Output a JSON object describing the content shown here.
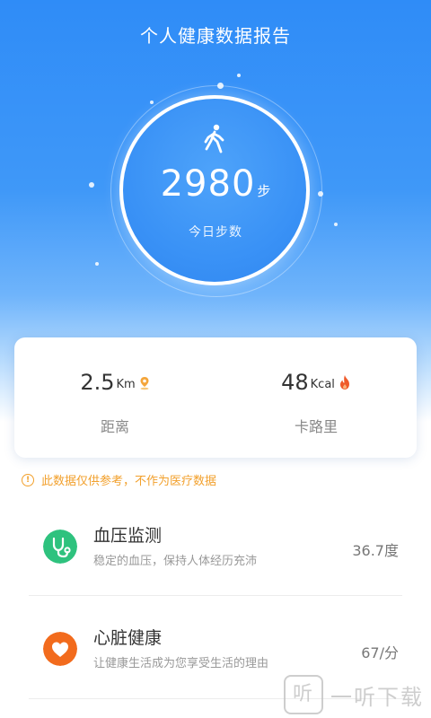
{
  "header": {
    "title": "个人健康数据报告"
  },
  "steps": {
    "value": "2980",
    "unit": "步",
    "label": "今日步数"
  },
  "stats": [
    {
      "value": "2.5",
      "unit": "Km",
      "label": "距离",
      "icon": "location-pin-icon"
    },
    {
      "value": "48",
      "unit": "Kcal",
      "label": "卡路里",
      "icon": "flame-icon"
    }
  ],
  "notice": {
    "text": "此数据仅供参考，不作为医疗数据"
  },
  "items": [
    {
      "title": "血压监测",
      "desc": "稳定的血压，保持人体经历充沛",
      "value": "36.7度",
      "icon": "stethoscope-icon",
      "color": "#2ec27e"
    },
    {
      "title": "心脏健康",
      "desc": "让健康生活成为您享受生活的理由",
      "value": "67/分",
      "icon": "heart-icon",
      "color": "#f26b1d"
    }
  ],
  "watermark": {
    "glyph": "听",
    "text": "一听下载"
  },
  "colors": {
    "primary_blue": "#2f8cf7",
    "notice_orange": "#f2a02c"
  }
}
